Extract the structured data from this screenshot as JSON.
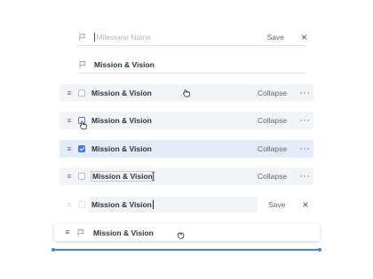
{
  "new_milestone": {
    "placeholder": "Milestone Name",
    "save_label": "Save",
    "close_glyph": "×"
  },
  "static_row": {
    "title": "Mission & Vision"
  },
  "rows": [
    {
      "title": "Mission & Vision",
      "collapse_label": "Collapse",
      "more_glyph": "···",
      "state": "hover-grab",
      "checked": false
    },
    {
      "title": "Mission & Vision",
      "collapse_label": "Collapse",
      "more_glyph": "···",
      "state": "checkbox-hover",
      "checked": false
    },
    {
      "title": "Mission & Vision",
      "collapse_label": "Collapse",
      "more_glyph": "···",
      "state": "selected",
      "checked": true
    },
    {
      "title": "Mission & Vision",
      "collapse_label": "Collapse",
      "more_glyph": "···",
      "state": "text-hover",
      "checked": false
    }
  ],
  "edit_row": {
    "value": "Mission & Vision",
    "save_label": "Save",
    "close_glyph": "×"
  },
  "drag_row": {
    "title": "Mission & Vision"
  },
  "drag_handle_glyph": "≡",
  "colors": {
    "row_bg": "#f3f4f6",
    "selected_bg": "#e3ecf9",
    "accent": "#3d7be0",
    "drop_line": "#4a86cf"
  },
  "icons": [
    "flag-icon",
    "drag-handle-icon",
    "checkbox-icon",
    "more-icon",
    "close-icon",
    "hand-cursor-icon",
    "text-cursor-icon"
  ]
}
